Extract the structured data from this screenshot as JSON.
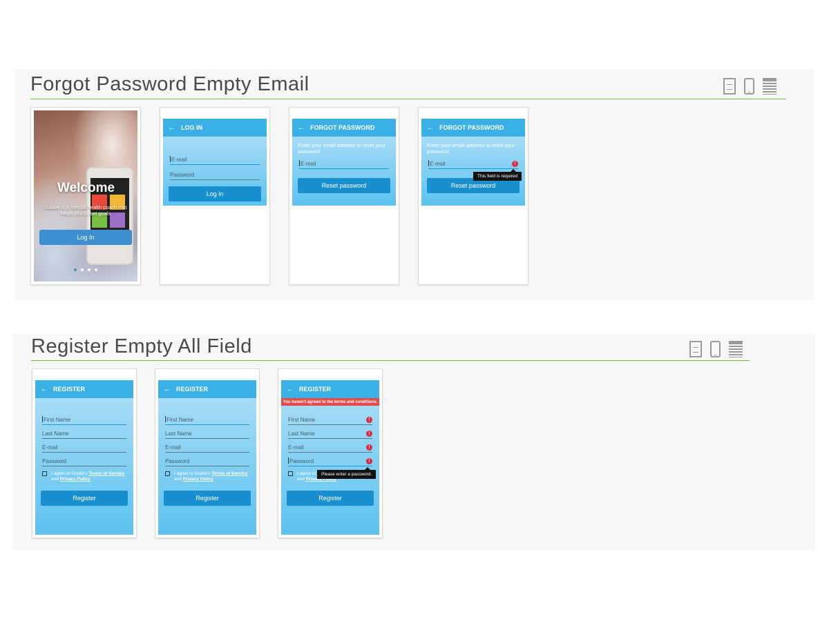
{
  "section1": {
    "title": "Forgot Password Empty Email",
    "screens": {
      "welcome": {
        "title": "Welcome",
        "subtitle": "Goalie is a mental health coach that helps you to set goals",
        "login_button": "Log In"
      },
      "login": {
        "appbar_title": "LOG IN",
        "email_placeholder": "E-mail",
        "password_placeholder": "Password",
        "button": "Log in"
      },
      "forgot1": {
        "appbar_title": "FORGOT PASSWORD",
        "hint": "Enter your email address to reset your password",
        "email_placeholder": "E-mail",
        "button": "Reset password"
      },
      "forgot2": {
        "appbar_title": "FORGOT PASSWORD",
        "hint": "Enter your email address to reset your password",
        "email_placeholder": "E-mail",
        "button": "Reset password",
        "tooltip": "This field is required",
        "error_glyph": "!"
      }
    }
  },
  "section2": {
    "title": "Register Empty All Field",
    "screens": {
      "reg1": {
        "appbar_title": "REGISTER",
        "first_name": "First Name",
        "last_name": "Last Name",
        "email": "E-mail",
        "password": "Password",
        "agree_prefix": "I agree to Goalie's",
        "terms": "Terms of Service",
        "and": "and",
        "privacy": "Privacy Policy",
        "button": "Register"
      },
      "reg2": {
        "appbar_title": "REGISTER",
        "first_name": "First Name",
        "last_name": "Last Name",
        "email": "E-mail",
        "password": "Password",
        "agree_prefix": "I agree to Goalie's",
        "terms": "Terms of Service",
        "and": "and",
        "privacy": "Privacy Policy",
        "button": "Register"
      },
      "reg3": {
        "appbar_title": "REGISTER",
        "banner": "You haven't agreed to the terms and conditions.",
        "first_name": "First Name",
        "last_name": "Last Name",
        "email": "E-mail",
        "password": "Password",
        "agree_prefix": "I agree to",
        "privacy": "Privacy Policy",
        "and": "and",
        "button": "Register",
        "tooltip": "Please enter a password.",
        "error_glyph": "!"
      }
    }
  },
  "icons": {
    "back": "←",
    "film": "film-icon",
    "phone": "phone-icon",
    "doc": "document-icon"
  },
  "colors": {
    "appbar": "#3ab0e6",
    "button": "#1a8fd0",
    "error": "#e3263b",
    "accent_line": "#6cbf4a"
  }
}
